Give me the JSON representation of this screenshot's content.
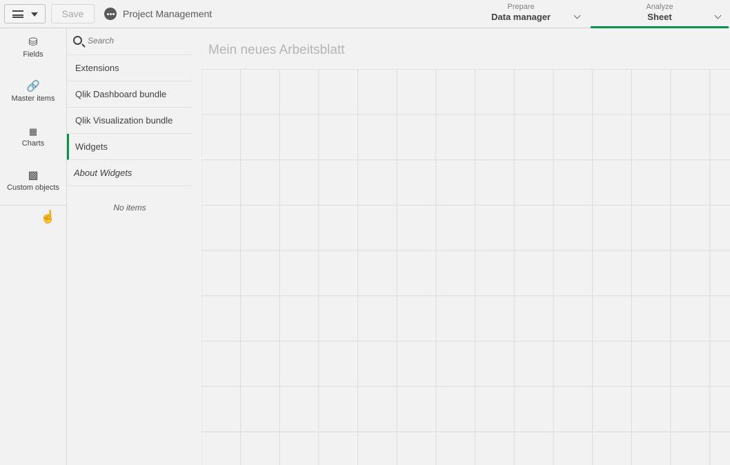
{
  "toolbar": {
    "save_label": "Save",
    "app_title": "Project Management"
  },
  "nav": [
    {
      "label": "Prepare",
      "value": "Data manager"
    },
    {
      "label": "Analyze",
      "value": "Sheet",
      "active": true
    }
  ],
  "sidebar": {
    "items": [
      {
        "label": "Fields",
        "icon": "database-icon"
      },
      {
        "label": "Master items",
        "icon": "link-icon"
      },
      {
        "label": "Charts",
        "icon": "bar-chart-icon"
      },
      {
        "label": "Custom objects",
        "icon": "puzzle-icon"
      }
    ]
  },
  "panel": {
    "search_placeholder": "Search",
    "items": [
      "Extensions",
      "Qlik Dashboard bundle",
      "Qlik Visualization bundle",
      "Widgets"
    ],
    "about": "About Widgets",
    "empty": "No items"
  },
  "sheet": {
    "title": "Mein neues Arbeitsblatt"
  },
  "colors": {
    "accent": "#009845"
  }
}
